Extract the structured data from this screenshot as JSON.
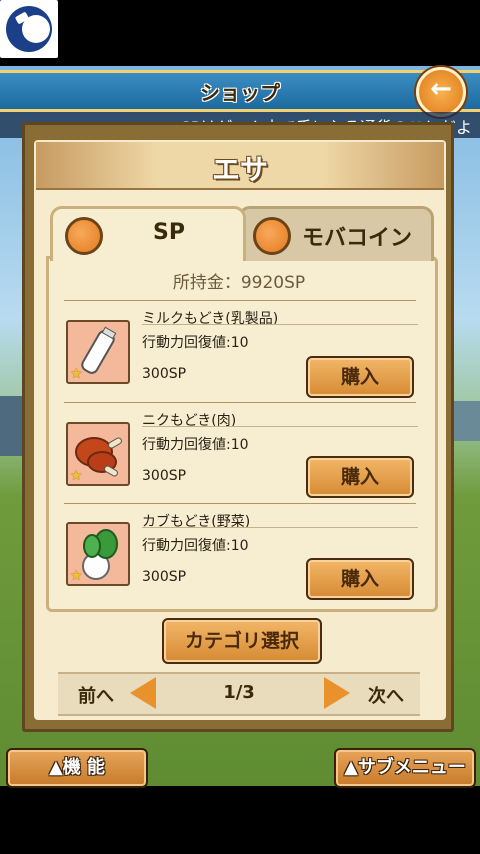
{
  "header": {
    "title": "ショップ",
    "back_icon": "back-arrow-icon"
  },
  "ticker": "SPはゲーム内で手に入る通貨のことだよ",
  "category": {
    "title": "エサ"
  },
  "tabs": [
    {
      "label": "SP",
      "selected": true
    },
    {
      "label": "モバコイン",
      "selected": false
    }
  ],
  "balance": "所持金：9920SP",
  "items": [
    {
      "name": "ミルクもどき(乳製品)",
      "effect": "行動力回復値:10",
      "price": "300SP",
      "buy_label": "購入",
      "icon": "milk-bottle-icon"
    },
    {
      "name": "ニクもどき(肉)",
      "effect": "行動力回復値:10",
      "price": "300SP",
      "buy_label": "購入",
      "icon": "meat-icon"
    },
    {
      "name": "カブもどき(野菜)",
      "effect": "行動力回復値:10",
      "price": "300SP",
      "buy_label": "購入",
      "icon": "turnip-icon"
    }
  ],
  "category_select_label": "カテゴリ選択",
  "pager": {
    "prev_label": "前へ",
    "page": "1/3",
    "next_label": "次へ"
  },
  "footer": {
    "function_label": "▲機 能",
    "submenu_label": "▲サブメニュー"
  },
  "colors": {
    "accent": "#e9922b",
    "title_bar": "#1d6aa0",
    "panel": "#f6eccd"
  }
}
